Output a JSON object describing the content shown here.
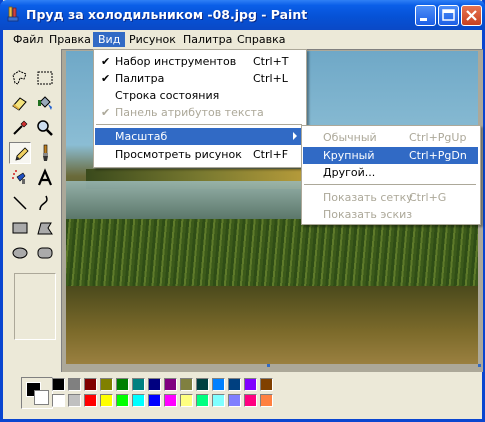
{
  "window": {
    "title": "Пруд за холодильником -08.jpg - Paint"
  },
  "menubar": [
    {
      "label": "Файл"
    },
    {
      "label": "Правка"
    },
    {
      "label": "Вид"
    },
    {
      "label": "Рисунок"
    },
    {
      "label": "Палитра"
    },
    {
      "label": "Справка"
    }
  ],
  "view_menu": {
    "items": [
      {
        "label": "Набор инструментов",
        "shortcut": "Ctrl+T",
        "checked": "✔"
      },
      {
        "label": "Палитра",
        "shortcut": "Ctrl+L",
        "checked": "✔"
      },
      {
        "label": "Строка состояния",
        "shortcut": ""
      },
      {
        "label": "Панель атрибутов текста",
        "shortcut": "",
        "checked": "✔"
      },
      {
        "label": "Масштаб",
        "shortcut": ""
      },
      {
        "label": "Просмотреть рисунок",
        "shortcut": "Ctrl+F"
      }
    ]
  },
  "zoom_menu": {
    "items": [
      {
        "label": "Обычный",
        "shortcut": "Ctrl+PgUp"
      },
      {
        "label": "Крупный",
        "shortcut": "Ctrl+PgDn"
      },
      {
        "label": "Другой...",
        "shortcut": ""
      },
      {
        "label": "Показать сетку",
        "shortcut": "Ctrl+G"
      },
      {
        "label": "Показать эскиз",
        "shortcut": ""
      }
    ]
  },
  "tools": [
    {
      "name": "free-form-select-icon"
    },
    {
      "name": "select-icon"
    },
    {
      "name": "eraser-icon"
    },
    {
      "name": "fill-icon"
    },
    {
      "name": "pick-color-icon"
    },
    {
      "name": "magnifier-icon"
    },
    {
      "name": "pencil-icon"
    },
    {
      "name": "brush-icon"
    },
    {
      "name": "airbrush-icon"
    },
    {
      "name": "text-icon"
    },
    {
      "name": "line-icon"
    },
    {
      "name": "curve-icon"
    },
    {
      "name": "rectangle-icon"
    },
    {
      "name": "polygon-icon"
    },
    {
      "name": "ellipse-icon"
    },
    {
      "name": "rounded-rectangle-icon"
    }
  ],
  "palette": {
    "foreground": "#000000",
    "background": "#ffffff",
    "colors_top": [
      "#000000",
      "#808080",
      "#800000",
      "#808000",
      "#008000",
      "#008080",
      "#000080",
      "#800080",
      "#808040",
      "#004040",
      "#0080ff",
      "#004080",
      "#8000ff",
      "#804000"
    ],
    "colors_bottom": [
      "#ffffff",
      "#c0c0c0",
      "#ff0000",
      "#ffff00",
      "#00ff00",
      "#00ffff",
      "#0000ff",
      "#ff00ff",
      "#ffff80",
      "#00ff80",
      "#80ffff",
      "#8080ff",
      "#ff0080",
      "#ff8040"
    ]
  }
}
